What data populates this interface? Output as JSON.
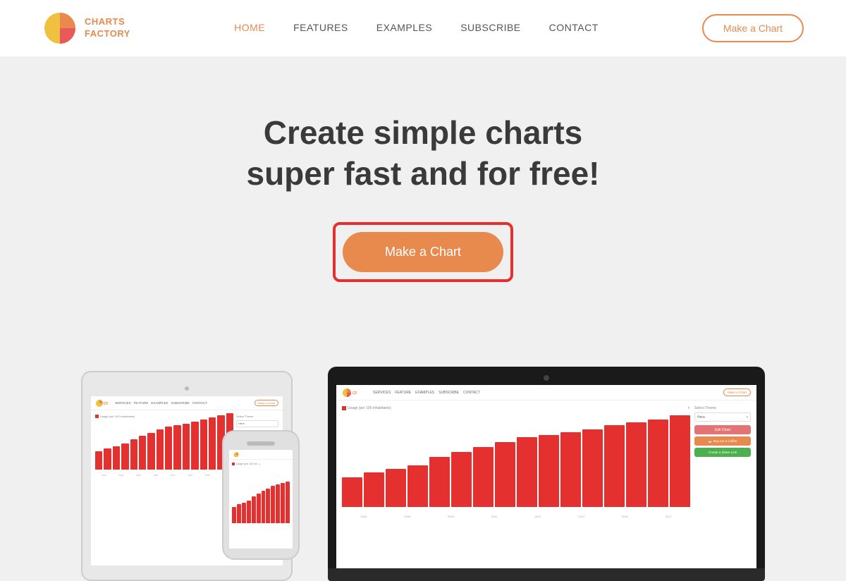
{
  "brand": {
    "logo_text_line1": "CHARTS",
    "logo_text_line2": "FACTORY"
  },
  "nav": {
    "links": [
      {
        "label": "HOME",
        "active": true
      },
      {
        "label": "FEATURES",
        "active": false
      },
      {
        "label": "EXAMPLES",
        "active": false
      },
      {
        "label": "SUBSCRIBE",
        "active": false
      },
      {
        "label": "CONTACT",
        "active": false
      }
    ],
    "cta_label": "Make a Chart"
  },
  "hero": {
    "title_line1": "Create simple charts",
    "title_line2": "super fast and for free!",
    "cta_label": "Make a Chart"
  },
  "mini_nav": {
    "links": [
      "SERVICES",
      "FEATURE",
      "EXAMPLES",
      "SUBSCRIBE",
      "CONTACT"
    ],
    "cta": "Make a Chart"
  },
  "mini_chart": {
    "title": "Usage (per 100 inhabitants)",
    "panel_title": "Select Theme",
    "theme_value": "Hera",
    "btn_edit": "Edit Chart",
    "btn_coffee": "Buy me a Coffee",
    "btn_link": "Create a Share Link",
    "bars": [
      30,
      35,
      38,
      42,
      50,
      55,
      60,
      65,
      70,
      72,
      75,
      78,
      82,
      85,
      88,
      92
    ],
    "x_labels": [
      "2004",
      "2006",
      "2008",
      "2010",
      "2012",
      "2014",
      "2016",
      "2017"
    ]
  },
  "accent_color": "#e8894e",
  "red_color": "#e53030"
}
